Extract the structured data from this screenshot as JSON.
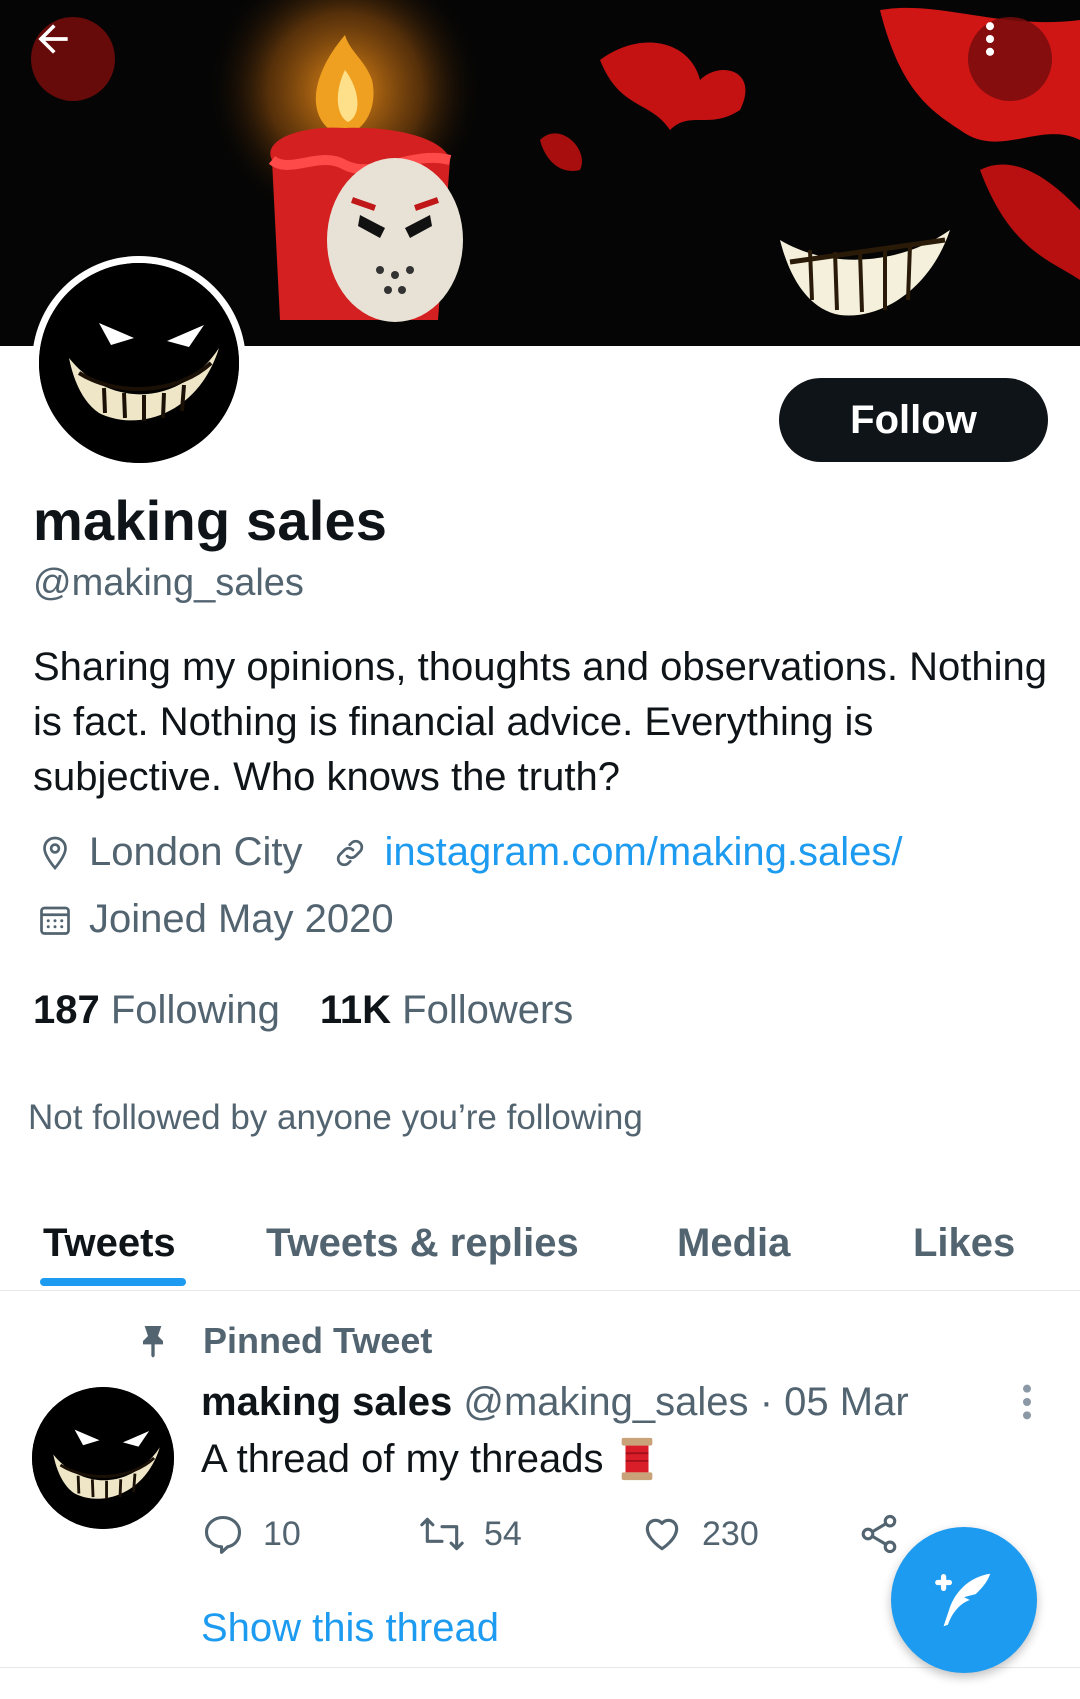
{
  "header": {
    "back_icon": "back-arrow-icon",
    "more_icon": "more-vertical-icon"
  },
  "profile": {
    "name": "making sales",
    "handle": "@making_sales",
    "follow_label": "Follow",
    "bio": "Sharing my opinions, thoughts and observations. Nothing is fact. Nothing is financial advice. Everything is subjective. Who knows the truth?",
    "location": "London City",
    "website": "instagram.com/making.sales/",
    "joined": "Joined May 2020",
    "following_count": "187",
    "following_label": "Following",
    "followers_count": "11K",
    "followers_label": "Followers",
    "not_followed_text": "Not followed by anyone you’re following"
  },
  "tabs": [
    {
      "label": "Tweets",
      "active": true
    },
    {
      "label": "Tweets & replies",
      "active": false
    },
    {
      "label": "Media",
      "active": false
    },
    {
      "label": "Likes",
      "active": false
    }
  ],
  "pinned_tweet": {
    "pinned_label": "Pinned Tweet",
    "author_name": "making sales",
    "author_handle": "@making_sales",
    "separator": "·",
    "date": "05 Mar",
    "text": "A thread of my threads",
    "emoji_icon": "thread-spool-icon",
    "replies": "10",
    "retweets": "54",
    "likes": "230",
    "show_thread": "Show this thread"
  },
  "colors": {
    "accent": "#1d9bf0",
    "text_primary": "#0f1419",
    "text_secondary": "#536471",
    "follow_button": "#0f1419"
  }
}
